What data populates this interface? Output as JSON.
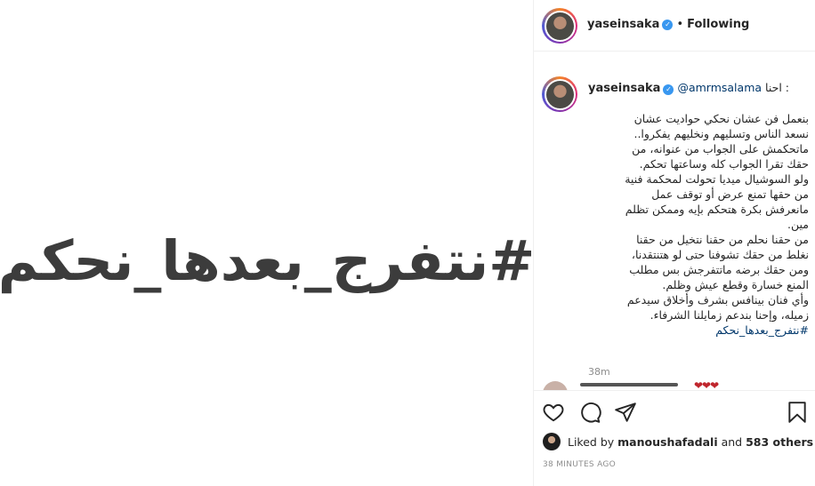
{
  "post": {
    "image_text": "#نتفرج_بعدها_نحكم"
  },
  "header": {
    "username": "yaseinsaka",
    "verified_mark": "✓",
    "separator": "•",
    "follow_state": "Following"
  },
  "caption": {
    "username": "yaseinsaka",
    "mention": "@amrmsalama",
    "lead": ": احنا",
    "lines": "بنعمل فن عشان نحكي حواديت عشان\nنسعد الناس وتسليهم ونخليهم يفكروا..\nماتحكمش على الجواب من عنوانه، من\nحقك تقرا الجواب كله وساعتها تحكم.\nولو السوشيال ميديا تحولت لمحكمة فنية\nمن حقها تمنع عرض أو توقف عمل\nمانعرفش بكرة هتحكم بإيه وممكن تظلم\nمين.\nمن حقنا نحلم من حقنا نتخيل من حقنا\nنغلط من حقك تشوفنا حتى لو هتنتقدنا،\nومن حقك برضه ماتتفرجش بس مطلب\nالمنع خسارة وقطع عيش وظلم.\nوأي فنان بينافس بشرف وأخلاق سيدعم\nزميله، وإحنا بندعم زمايلنا الشرفاء.",
    "hashtag": "#نتفرج_بعدها_نحكم",
    "time_ago": "38m"
  },
  "next_comment": {
    "hearts": "❤❤❤"
  },
  "engagement": {
    "liked_by_prefix": "Liked by",
    "liked_by_user": "manoushafadali",
    "and_word": "and",
    "others": "583 others",
    "posted_ago": "38 MINUTES AGO"
  }
}
